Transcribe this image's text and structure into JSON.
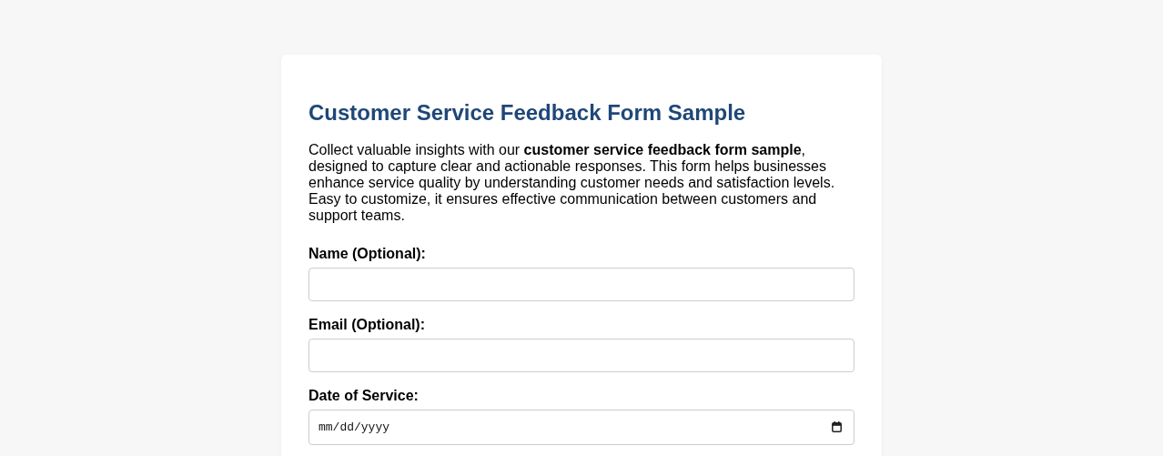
{
  "form": {
    "title": "Customer Service Feedback Form Sample",
    "intro": "Collect valuable insights with our **customer service feedback form sample**, designed to capture clear and actionable responses. This form helps businesses enhance service quality by understanding customer needs and satisfaction levels. Easy to customize, it ensures effective communication between customers and support teams.",
    "fields": [
      {
        "kind": "text",
        "label": "Name (Optional):"
      },
      {
        "kind": "text",
        "label": "Email (Optional):"
      },
      {
        "kind": "date",
        "label": "Date of Service:",
        "placeholder": "mm/dd/yyyy"
      }
    ]
  }
}
